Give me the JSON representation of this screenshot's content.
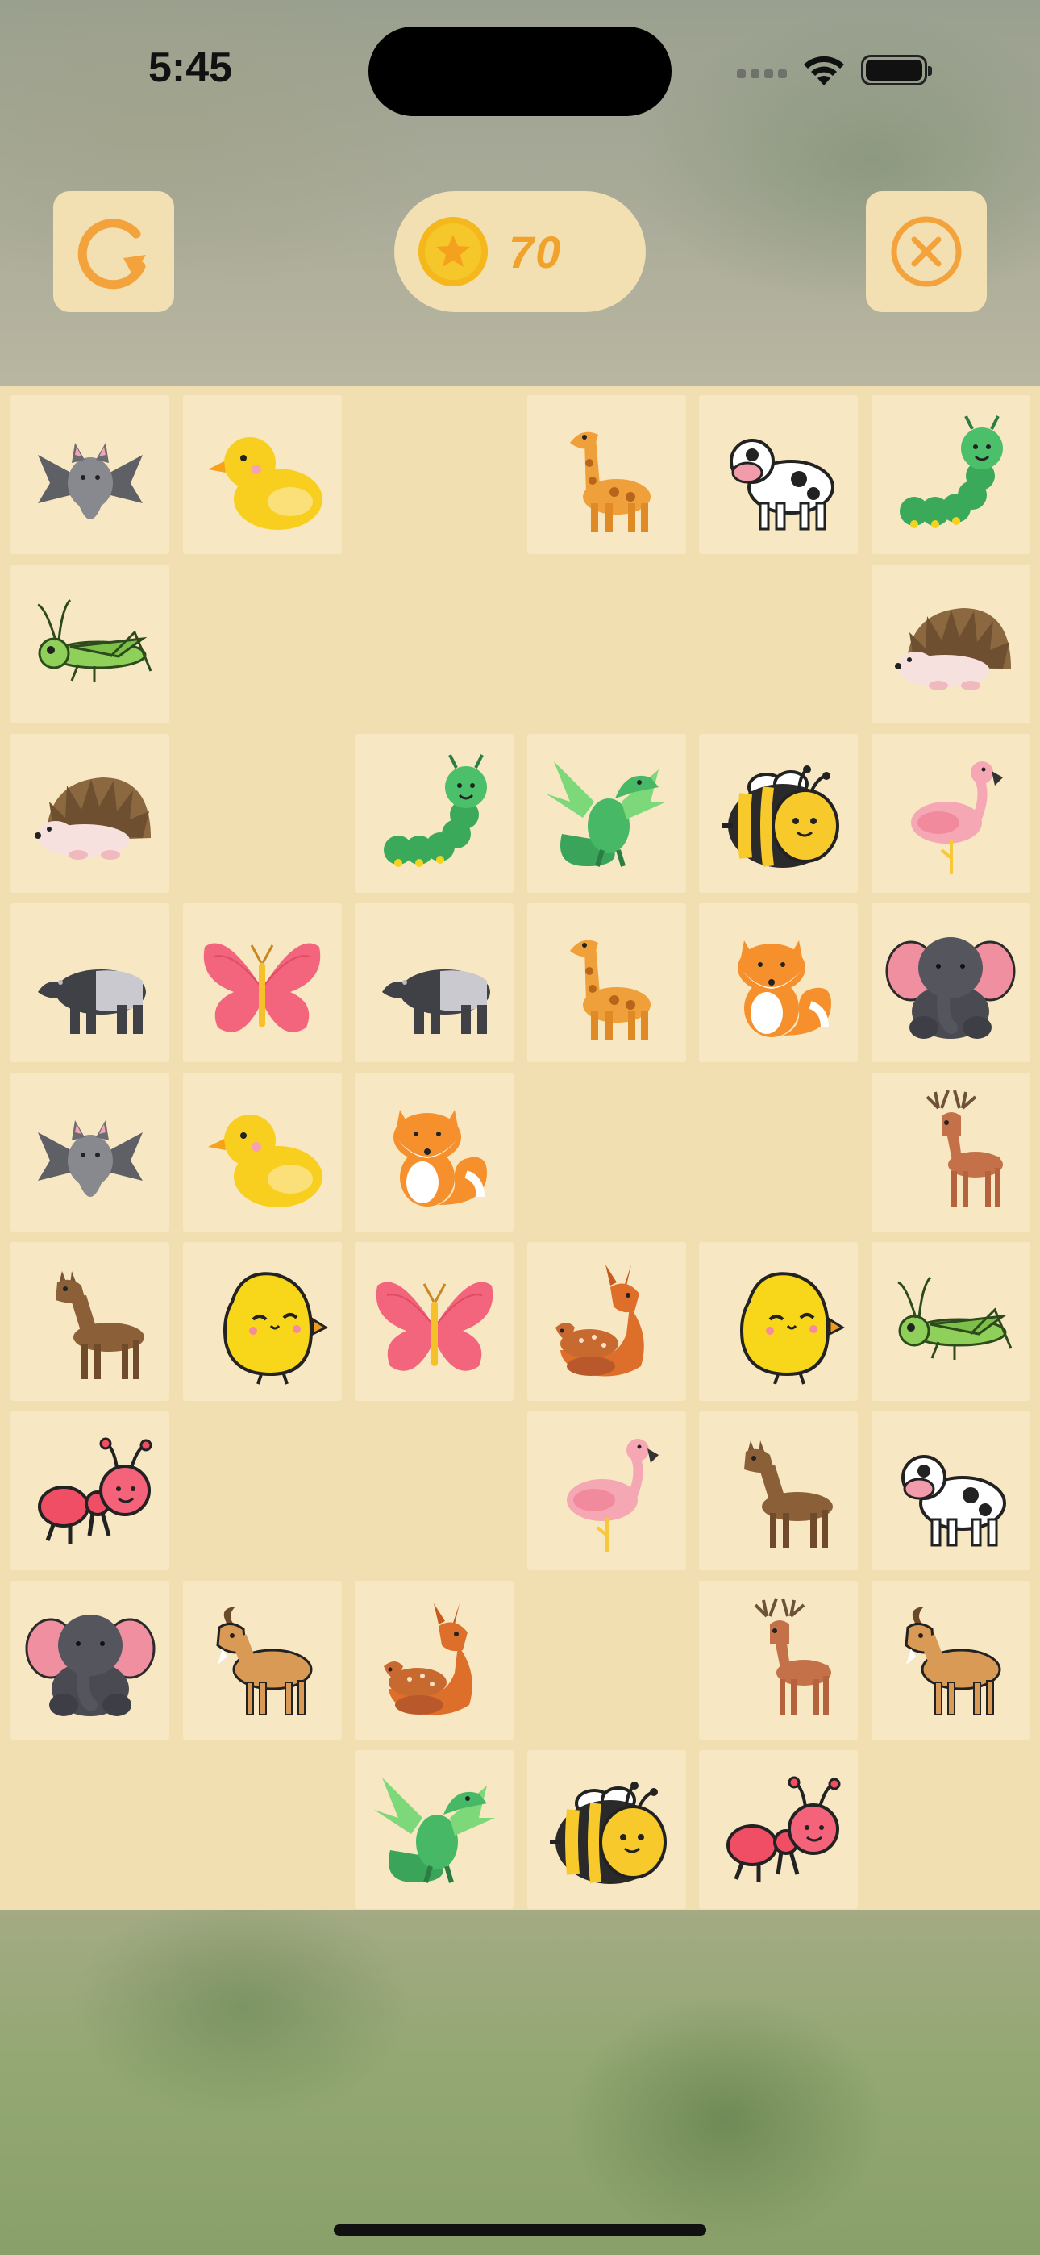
{
  "status_bar": {
    "time": "5:45"
  },
  "header": {
    "coins": "70",
    "restart_icon": "restart-icon",
    "close_icon": "close-icon",
    "coin_icon": "coin-star-icon"
  },
  "colors": {
    "accent": "#f0a22a",
    "board": "#f2dfb1",
    "tile": "#f7e7c3",
    "button": "#f2dfb2"
  },
  "board": {
    "columns": 6,
    "rows": 9,
    "tiles": [
      [
        "bat",
        "duck",
        null,
        "giraffe",
        "cow",
        "caterpillar"
      ],
      [
        "grasshopper",
        null,
        null,
        null,
        null,
        "hedgehog"
      ],
      [
        "hedgehog",
        null,
        "caterpillar",
        "dragon",
        "bee",
        "flamingo"
      ],
      [
        "tapir",
        "butterfly",
        "tapir",
        "giraffe",
        "fox",
        "elephant"
      ],
      [
        "bat",
        "duck",
        "fox",
        null,
        null,
        "deer"
      ],
      [
        "llama",
        "chick",
        "butterfly",
        "fawns",
        "chick",
        "grasshopper"
      ],
      [
        "ant",
        null,
        null,
        "flamingo",
        "llama",
        "cow"
      ],
      [
        "elephant",
        "goat",
        "fawns",
        null,
        "deer",
        "goat"
      ],
      [
        null,
        null,
        "dragon",
        "bee",
        "ant",
        null
      ]
    ]
  }
}
